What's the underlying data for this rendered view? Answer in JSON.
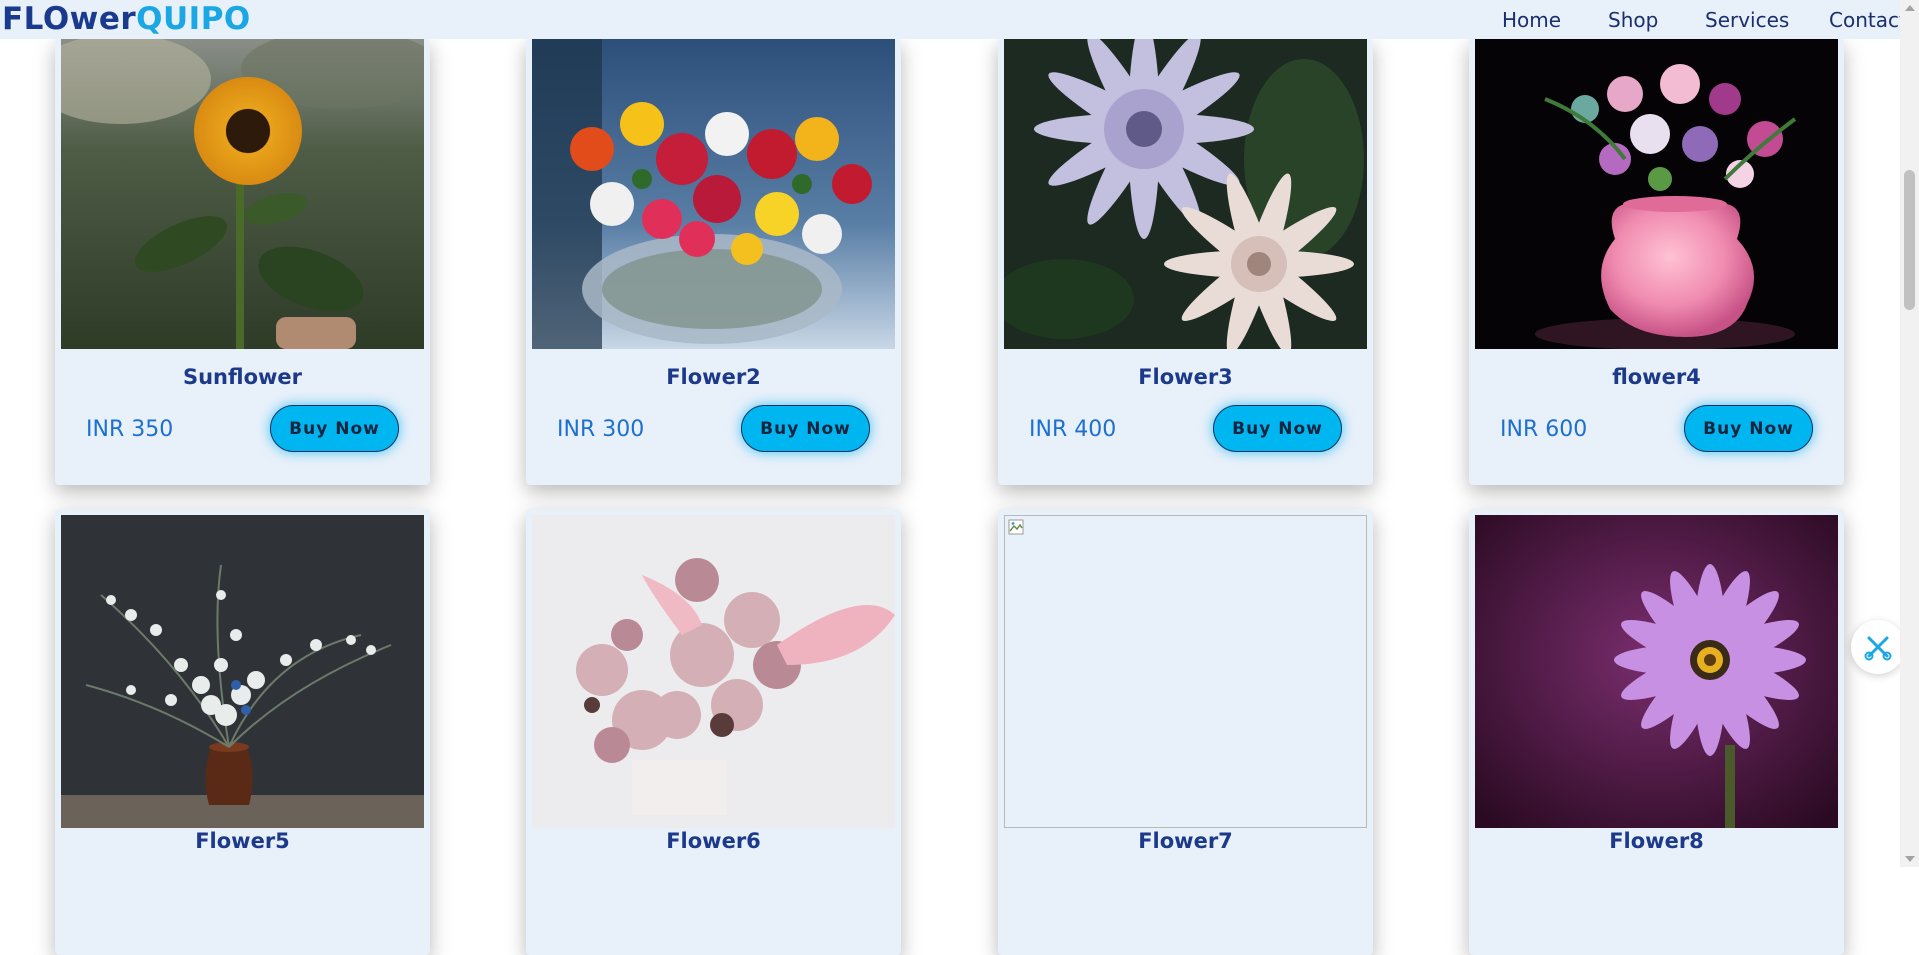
{
  "brand": {
    "part1": "FLOwer",
    "part2": "QUIPO"
  },
  "nav": {
    "home": "Home",
    "shop": "Shop",
    "services": "Services",
    "contact": "Contact"
  },
  "products": [
    {
      "name": "Sunflower",
      "price": "INR 350",
      "button": "Buy Now"
    },
    {
      "name": "Flower2",
      "price": "INR 300",
      "button": "Buy Now"
    },
    {
      "name": "Flower3",
      "price": "INR 400",
      "button": "Buy Now"
    },
    {
      "name": "flower4",
      "price": "INR 600",
      "button": "Buy Now"
    },
    {
      "name": "Flower5"
    },
    {
      "name": "Flower6"
    },
    {
      "name": "Flower7"
    },
    {
      "name": "Flower8"
    }
  ],
  "colors": {
    "navbar_bg": "#e8f0fa",
    "brand_dark": "#1a3a8e",
    "brand_light": "#1aa7e4",
    "card_bg": "#e8f0fa",
    "button_bg": "#00b6f1",
    "price_text": "#1d6fd0",
    "title_text": "#1d3a8a"
  },
  "icons": {
    "floating_widget": "scissors-icon",
    "broken_image": "broken-image-icon"
  }
}
